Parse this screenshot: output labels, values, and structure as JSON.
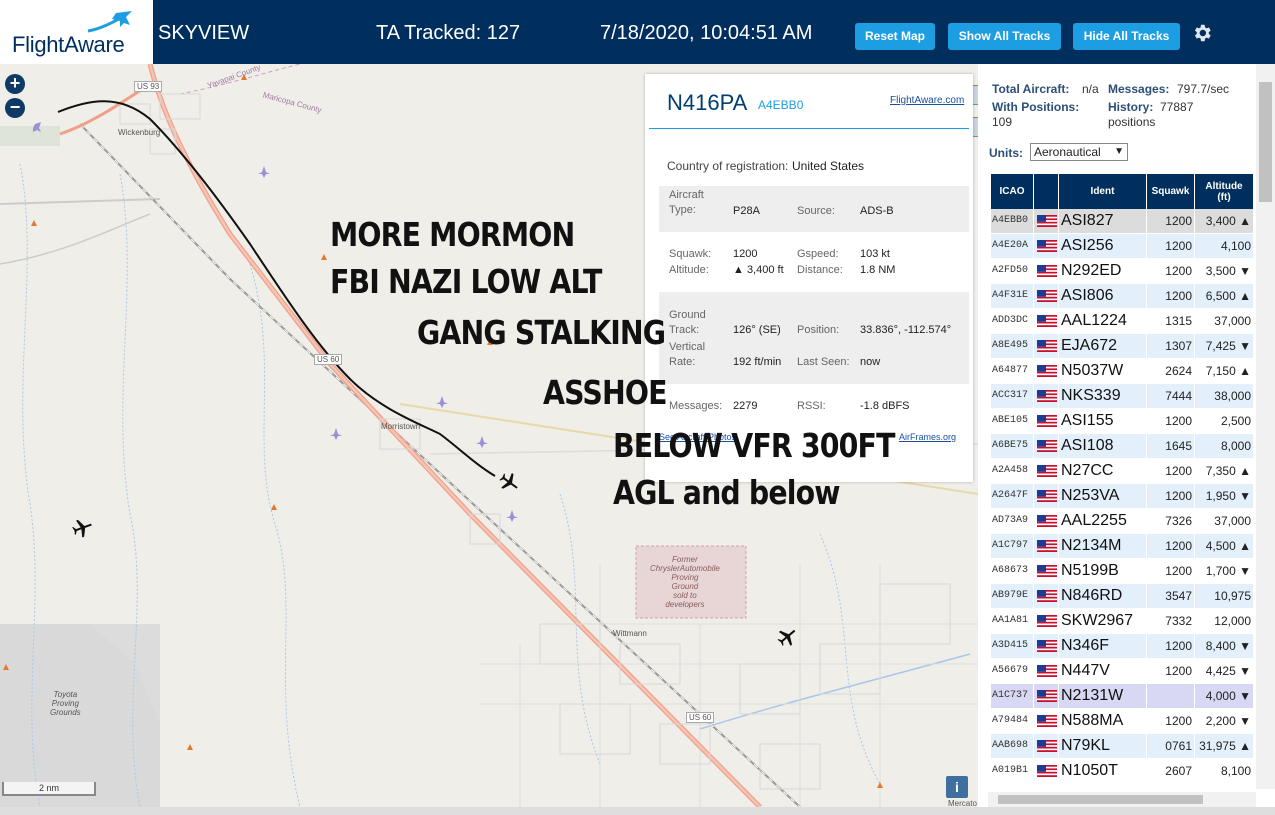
{
  "header": {
    "logo_text": "FlightAware",
    "site_name": "SKYVIEW",
    "tracked_text": "TA Tracked: 127",
    "datetime": "7/18/2020, 10:04:51 AM",
    "btn_reset": "Reset Map",
    "btn_show": "Show All Tracks",
    "btn_hide": "Hide All Tracks",
    "accent_color": "#1d9ee3",
    "bar_color": "#002f5d"
  },
  "map": {
    "zoom_in": "+",
    "zoom_out": "−",
    "scale_label": "2 nm",
    "info_label": "i",
    "attribution": "Mercato",
    "labels": {
      "yavapai": "Yavapai County",
      "maricopa": "Maricopa County",
      "us93": "US 93",
      "wickenburg": "Wickenburg",
      "us60a": "US 60",
      "us60b": "US 60",
      "morristown": "Morristown",
      "wittmann": "Wittmann",
      "toyota": "Toyota\nProving\nGrounds",
      "chrysler": "Former\nChryslerAutomobile\nProving\nGround\nsold to\ndevelopers"
    },
    "overlay": {
      "line1": "MORE MORMON",
      "line2": "FBI NAZI LOW ALT",
      "line3": "GANG STALKING",
      "line4": "ASSHOE",
      "line5": "BELOW VFR 300FT",
      "line6": "AGL and below"
    }
  },
  "popup": {
    "registration": "N416PA",
    "icao": "A4EBB0",
    "flightaware_link": "FlightAware.com",
    "country_label": "Country of registration:",
    "country_value": "United States",
    "aircraft_type_label": "Aircraft\nType:",
    "aircraft_type_value": "P28A",
    "source_label": "Source:",
    "source_value": "ADS-B",
    "squawk_label": "Squawk:",
    "squawk_value": "1200",
    "altitude_label": "Altitude:",
    "altitude_value": "▲ 3,400 ft",
    "gspeed_label": "Gspeed:",
    "gspeed_value": "103 kt",
    "distance_label": "Distance:",
    "distance_value": "1.8 NM",
    "track_label": "Ground\nTrack:",
    "track_value": "126° (SE)",
    "position_label": "Position:",
    "position_value": "33.836°, -112.574°",
    "vrate_label": "Vertical\nRate:",
    "vrate_value": "192 ft/min",
    "lastseen_label": "Last Seen:",
    "lastseen_value": "now",
    "messages_label": "Messages:",
    "messages_value": "2279",
    "rssi_label": "RSSI:",
    "rssi_value": "-1.8 dBFS",
    "link_left": "See Aircraft Photos",
    "link_right": "AirFrames.org"
  },
  "stats": {
    "total_label": "Total Aircraft:",
    "total_value": "n/a",
    "messages_label": "Messages:",
    "messages_value": "797.7/sec",
    "positions_label": "With Positions:",
    "positions_value": "109",
    "history_label": "History:",
    "history_value": "77887\npositions",
    "units_label": "Units:",
    "units_value": "Aeronautical"
  },
  "table": {
    "headers": {
      "icao": "ICAO",
      "flag": "",
      "ident": "Ident",
      "squawk": "Squawk",
      "altitude": "Altitude\n(ft)"
    },
    "rows": [
      {
        "icao": "A4EBB0",
        "ident": "ASI827",
        "squawk": "1200",
        "alt": "3,400 ▲"
      },
      {
        "icao": "A4E20A",
        "ident": "ASI256",
        "squawk": "1200",
        "alt": "4,100"
      },
      {
        "icao": "A2FD50",
        "ident": "N292ED",
        "squawk": "1200",
        "alt": "3,500 ▼"
      },
      {
        "icao": "A4F31E",
        "ident": "ASI806",
        "squawk": "1200",
        "alt": "6,500 ▲"
      },
      {
        "icao": "ADD3DC",
        "ident": "AAL1224",
        "squawk": "1315",
        "alt": "37,000"
      },
      {
        "icao": "A8E495",
        "ident": "EJA672",
        "squawk": "1307",
        "alt": "7,425 ▼"
      },
      {
        "icao": "A64877",
        "ident": "N5037W",
        "squawk": "2624",
        "alt": "7,150 ▲"
      },
      {
        "icao": "ACC317",
        "ident": "NKS339",
        "squawk": "7444",
        "alt": "38,000"
      },
      {
        "icao": "ABE105",
        "ident": "ASI155",
        "squawk": "1200",
        "alt": "2,500"
      },
      {
        "icao": "A6BE75",
        "ident": "ASI108",
        "squawk": "1645",
        "alt": "8,000"
      },
      {
        "icao": "A2A458",
        "ident": "N27CC",
        "squawk": "1200",
        "alt": "7,350 ▲"
      },
      {
        "icao": "A2647F",
        "ident": "N253VA",
        "squawk": "1200",
        "alt": "1,950 ▼"
      },
      {
        "icao": "AD73A9",
        "ident": "AAL2255",
        "squawk": "7326",
        "alt": "37,000"
      },
      {
        "icao": "A1C797",
        "ident": "N2134M",
        "squawk": "1200",
        "alt": "4,500 ▲"
      },
      {
        "icao": "A68673",
        "ident": "N5199B",
        "squawk": "1200",
        "alt": "1,700 ▼"
      },
      {
        "icao": "AB979E",
        "ident": "N846RD",
        "squawk": "3547",
        "alt": "10,975"
      },
      {
        "icao": "AA1A81",
        "ident": "SKW2967",
        "squawk": "7332",
        "alt": "12,000"
      },
      {
        "icao": "A3D415",
        "ident": "N346F",
        "squawk": "1200",
        "alt": "8,400 ▼"
      },
      {
        "icao": "A56679",
        "ident": "N447V",
        "squawk": "1200",
        "alt": "4,425 ▼"
      },
      {
        "icao": "A1C737",
        "ident": "N2131W",
        "squawk": "",
        "alt": "4,000 ▼"
      },
      {
        "icao": "A79484",
        "ident": "N588MA",
        "squawk": "1200",
        "alt": "2,200 ▼"
      },
      {
        "icao": "AAB698",
        "ident": "N79KL",
        "squawk": "0761",
        "alt": "31,975 ▲"
      },
      {
        "icao": "A019B1",
        "ident": "N1050T",
        "squawk": "2607",
        "alt": "8,100"
      }
    ]
  }
}
